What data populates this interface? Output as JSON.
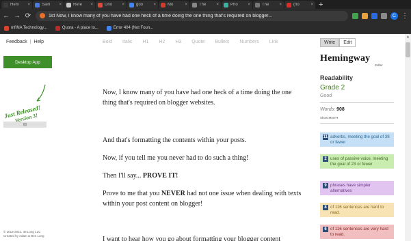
{
  "browser": {
    "tabs": [
      {
        "title": "Hem",
        "color": "#3b3b3b"
      },
      {
        "title": "Sam",
        "color": "#4a7be0"
      },
      {
        "title": "Rere",
        "color": "#c8c8c8"
      },
      {
        "title": "Dno",
        "color": "#e04a3a"
      },
      {
        "title": "goo",
        "color": "#4285f4"
      },
      {
        "title": "Mo",
        "color": "#d23a2a"
      },
      {
        "title": "The",
        "color": "#888888"
      },
      {
        "title": "Pho",
        "color": "#3fb0a0"
      },
      {
        "title": "The",
        "color": "#777777"
      },
      {
        "title": "(no",
        "color": "#e02a2a"
      }
    ],
    "new_tab": "+",
    "url": "1st Now, I know many of you have had one heck of a time doing the one thing that's required on blogger...",
    "profile_initial": "C",
    "bookmarks": [
      {
        "label": "mfINA Technology...",
        "color": "#d8452c"
      },
      {
        "label": "Quora - A place to...",
        "color": "#b92b27"
      },
      {
        "label": "Error 404 (Not Foun...",
        "color": "#4285f4"
      }
    ]
  },
  "app": {
    "top_links": {
      "feedback": "Feedback",
      "help": "Help"
    },
    "toolbar": [
      "Bold",
      "Italic",
      "H1",
      "H2",
      "H3",
      "Quote",
      "Bullets",
      "Numbers",
      "Link"
    ],
    "desktop_button": "Desktop App",
    "promo_text": [
      "Just Released!",
      "Version 3!"
    ],
    "collapse_icon": "minimize-icon",
    "footer": [
      "© 2013-2021. 38 Long LLC",
      "Created by Adam & Ben Long"
    ],
    "editor_paragraphs": [
      {
        "text": "Now, I know many of you have had one heck of a time doing the one thing that's required on blogger websites."
      },
      {
        "text": "And that's formatting the contents within your posts."
      },
      {
        "text": "Now, if you tell me you never had to do such a thing!"
      },
      {
        "before": "Then I'll say... ",
        "bold": "PROVE IT!",
        "after": ""
      },
      {
        "before": "Prove to me that you ",
        "bold": "NEVER",
        "after": " had not one issue when dealing with texts within your post content on blogger!"
      },
      {
        "text": "I want to hear how you go about formatting your blogger content"
      }
    ],
    "sidebar": {
      "mode_write": "Write",
      "mode_edit": "Edit",
      "logo": "Hemingway",
      "logo_sub": "Editor",
      "readability_title": "Readability",
      "grade": "Grade 2",
      "grade_word": "Good",
      "words_label": "Words:",
      "words_count": "908",
      "show_more": "Show More ▾",
      "cards": [
        {
          "num": "11",
          "text": "adverbs, meeting the goal of 38 or fewer",
          "bg": "#c4dff6",
          "fg": "#2d6a93"
        },
        {
          "num": "2",
          "text": "uses of passive voice, meeting the goal of 23 or fewer",
          "bg": "#c9ecb1",
          "fg": "#3d6a1f"
        },
        {
          "num": "9",
          "text": "phrases have simpler alternatives",
          "bg": "#e2c4f0",
          "fg": "#6a3a86"
        },
        {
          "num": "8",
          "text": "of 116 sentences are hard to read.",
          "bg": "#f7e3b3",
          "fg": "#8a6a1f"
        },
        {
          "num": "6",
          "text": "of 116 sentences are very hard to read.",
          "bg": "#f1bfbf",
          "fg": "#8a2a2a"
        }
      ]
    }
  }
}
